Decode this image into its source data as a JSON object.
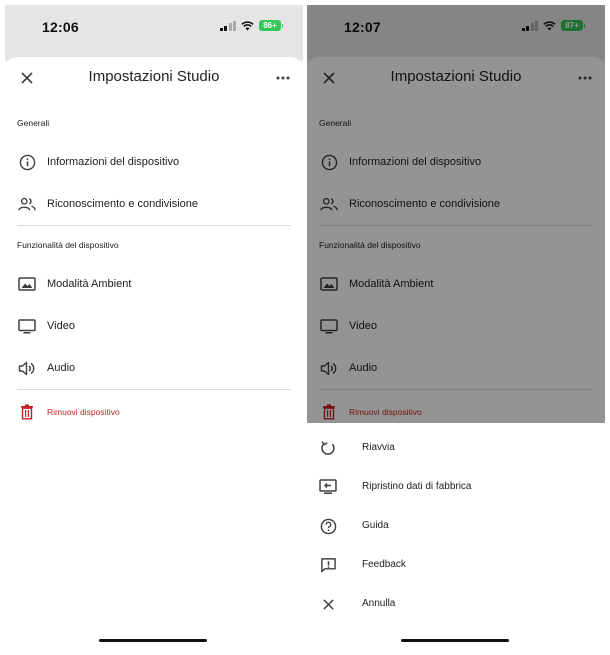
{
  "left": {
    "status": {
      "time": "12:06",
      "battery": "86+"
    },
    "title": "Impostazioni Studio",
    "sections": [
      {
        "header": "Generali"
      },
      {
        "header": "Funzionalità del dispositivo"
      }
    ],
    "items": {
      "info": "Informazioni del dispositivo",
      "recognition": "Riconoscimento e condivisione",
      "ambient": "Modalità Ambient",
      "video": "Video",
      "audio": "Audio",
      "remove": "Rimuovi dispositivo"
    }
  },
  "right": {
    "status": {
      "time": "12:07",
      "battery": "87+"
    },
    "title": "Impostazioni Studio",
    "sections": [
      {
        "header": "Generali"
      },
      {
        "header": "Funzionalità del dispositivo"
      }
    ],
    "items": {
      "info": "Informazioni del dispositivo",
      "recognition": "Riconoscimento e condivisione",
      "ambient": "Modalità Ambient",
      "video": "Video",
      "audio": "Audio",
      "remove": "Rimuovi dispositivo"
    },
    "menu": {
      "restart": "Riavvia",
      "factory_reset": "Ripristino dati di fabbrica",
      "help": "Guida",
      "feedback": "Feedback",
      "cancel": "Annulla"
    }
  },
  "colors": {
    "danger": "#c5221f",
    "battery": "#34c759",
    "statusbar": "#e5e5e5"
  },
  "icons": [
    "close-icon",
    "more-icon",
    "info-icon",
    "people-icon",
    "photo-frame-icon",
    "monitor-icon",
    "speaker-icon",
    "trash-icon",
    "restart-icon",
    "factory-reset-icon",
    "help-icon",
    "feedback-icon",
    "cancel-icon"
  ]
}
